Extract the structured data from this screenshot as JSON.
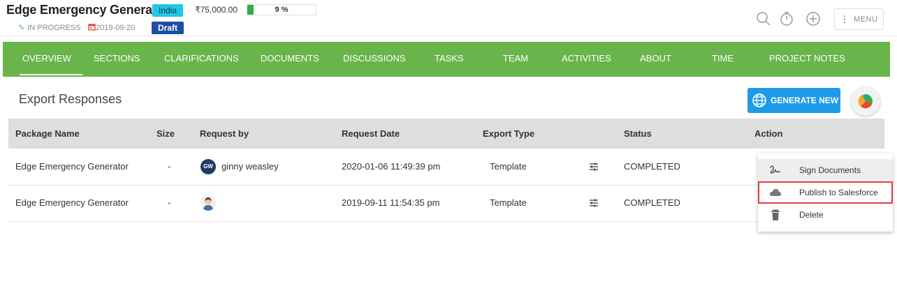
{
  "header": {
    "project_title": "Edge Emergency Generator",
    "country": "India",
    "budget": "₹75,000.00",
    "progress_percent": 9,
    "progress_label": "9 %",
    "status": "IN PROGRESS",
    "date": "2019-09-20",
    "stage": "Draft",
    "menu_label": "MENU",
    "icons": [
      "search-icon",
      "timer-icon",
      "add-icon",
      "kebab-icon"
    ]
  },
  "nav": {
    "tabs": [
      {
        "label": "OVERVIEW",
        "active": true
      },
      {
        "label": "SECTIONS"
      },
      {
        "label": "CLARIFICATIONS"
      },
      {
        "label": "DOCUMENTS"
      },
      {
        "label": "DISCUSSIONS"
      },
      {
        "label": "TASKS"
      },
      {
        "label": "TEAM"
      },
      {
        "label": "ACTIVITIES"
      },
      {
        "label": "ABOUT"
      },
      {
        "label": "TIME"
      },
      {
        "label": "PROJECT NOTES"
      }
    ]
  },
  "section": {
    "title": "Export Responses",
    "generate_label": "GENERATE NEW"
  },
  "table": {
    "headers": {
      "package": "Package Name",
      "size": "Size",
      "request_by": "Request by",
      "request_date": "Request Date",
      "export_type": "Export Type",
      "status": "Status",
      "action": "Action"
    },
    "rows": [
      {
        "package": "Edge Emergency Generator",
        "size": "-",
        "avatar_initials": "GW",
        "request_by": "ginny weasley",
        "request_date": "2020-01-06 11:49:39 pm",
        "export_type": "Template",
        "status": "COMPLETED"
      },
      {
        "package": "Edge Emergency Generator",
        "size": "-",
        "avatar_initials": "",
        "request_by": "",
        "request_date": "2019-09-11 11:54:35 pm",
        "export_type": "Template",
        "status": "COMPLETED"
      }
    ]
  },
  "action_menu": {
    "items": [
      {
        "label": "Sign Documents",
        "icon": "signature-icon"
      },
      {
        "label": "Publish to Salesforce",
        "icon": "cloud-icon"
      },
      {
        "label": "Delete",
        "icon": "trash-icon"
      }
    ]
  },
  "colors": {
    "nav_green": "#6ab54b",
    "generate_blue": "#1d9be8",
    "country_badge": "#1fc8e6",
    "draft_badge": "#1d4fa0",
    "progress_fill": "#2bb24c",
    "highlight_red": "#e0403f"
  }
}
